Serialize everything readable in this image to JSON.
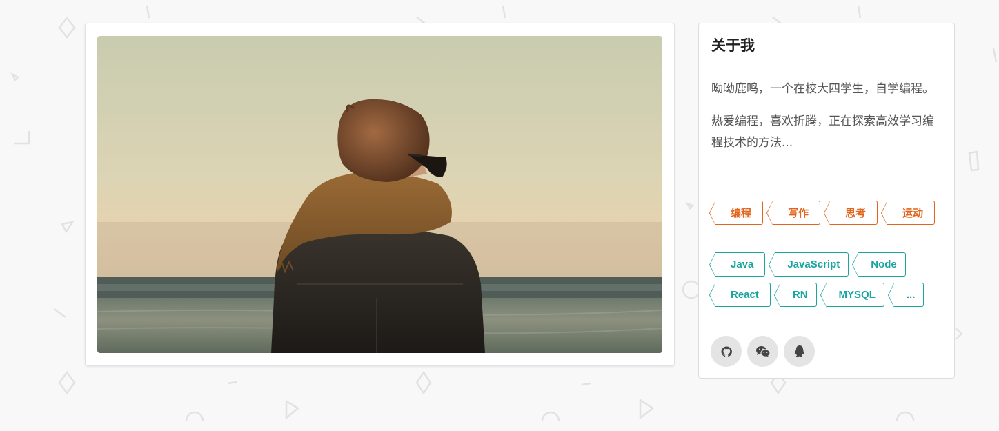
{
  "about": {
    "title": "关于我",
    "paragraphs": [
      "呦呦鹿鸣，一个在校大四学生，自学编程。",
      "热爱编程，喜欢折腾，正在探索高效学习编程技术的方法..."
    ]
  },
  "interest_tags": [
    "编程",
    "写作",
    "思考",
    "运动"
  ],
  "skill_tags": [
    "Java",
    "JavaScript",
    "Node",
    "React",
    "RN",
    "MYSQL",
    "..."
  ],
  "social": [
    {
      "name": "github-icon"
    },
    {
      "name": "wechat-icon"
    },
    {
      "name": "qq-icon"
    }
  ],
  "colors": {
    "interest_tag": "#e1651f",
    "skill_tag": "#1aa5a0",
    "social_bg": "#e4e4e4",
    "page_bg": "#f8f8f8"
  }
}
